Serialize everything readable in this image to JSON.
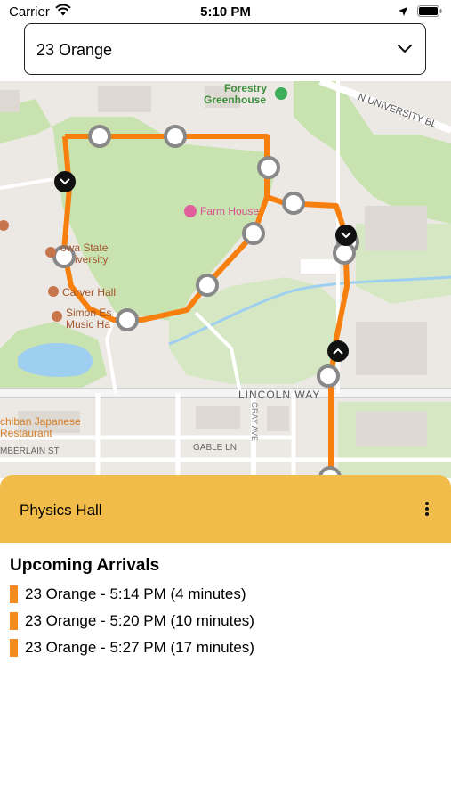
{
  "status_bar": {
    "carrier": "Carrier",
    "time": "5:10 PM"
  },
  "route_selector": {
    "selected": "23 Orange"
  },
  "map": {
    "labels": {
      "forestry_greenhouse_1": "Forestry",
      "forestry_greenhouse_2": "Greenhouse",
      "n_university": "N UNIVERSITY BL",
      "farm_house": "Farm House",
      "iowa_state_1": "owa State",
      "iowa_state_2": "iversity",
      "carver_hall": "Carver Hall",
      "simon_estes_1": "Simon Es",
      "simon_estes_2": "Music Ha",
      "lincoln_way": "LINCOLN WAY",
      "gray_ave": "GRAY AVE",
      "gable_ln": "GABLE LN",
      "ichiban_1": "chiban Japanese",
      "ichiban_2": "Restaurant",
      "chamberlain": "MBERLAIN ST"
    }
  },
  "stop_panel": {
    "stop_name": "Physics Hall",
    "arrivals_title": "Upcoming Arrivals",
    "arrivals": [
      {
        "text": "23 Orange - 5:14 PM (4 minutes)"
      },
      {
        "text": "23 Orange - 5:20 PM (10 minutes)"
      },
      {
        "text": "23 Orange - 5:27 PM (17 minutes)"
      }
    ]
  },
  "colors": {
    "route": "#f77f0e",
    "panel": "#f2bc4a",
    "swatch": "#f58a1f"
  },
  "icons": [
    "wifi-icon",
    "location-arrow-icon",
    "battery-icon",
    "chevron-down-icon",
    "more-vertical-icon",
    "bus-down-marker-icon",
    "bus-up-marker-icon"
  ]
}
